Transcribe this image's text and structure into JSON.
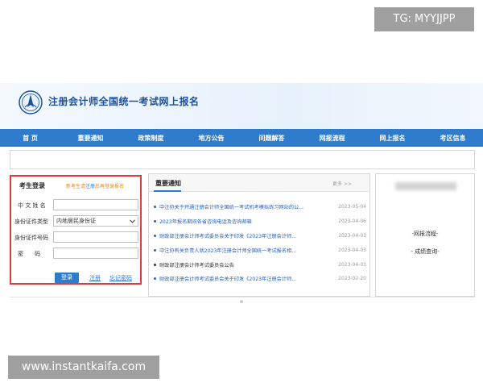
{
  "watermarks": {
    "top": "TG: MYYJJPP",
    "bottom": "www.instantkaifa.com"
  },
  "header": {
    "title": "注册会计师全国统一考试网上报名",
    "logo_icon": "cicpa-logo-icon"
  },
  "nav": {
    "items": [
      {
        "label": "首 页"
      },
      {
        "label": "重要通知"
      },
      {
        "label": "政策制度"
      },
      {
        "label": "地方公告"
      },
      {
        "label": "问题解答"
      },
      {
        "label": "网报流程"
      },
      {
        "label": "网上报名"
      },
      {
        "label": "考区信息"
      }
    ]
  },
  "login": {
    "title": "考生登录",
    "hint_prefix": "新考生请",
    "hint_link": "注册",
    "hint_suffix": "后再登录报名",
    "name_label": "中 文 姓 名",
    "name_value": "",
    "id_type_label": "身份证件类型",
    "id_type_value": "内地居民身份证",
    "id_number_label": "身份证件号码",
    "id_number_value": "",
    "password_label": "密　　码",
    "password_value": "",
    "login_button": "登录",
    "register_link": "注册",
    "forgot_link": "忘记密码"
  },
  "notices": {
    "title": "重要通知",
    "more": "更多 >>",
    "items": [
      {
        "title": "中注协关于开通注册会计师全国统一考试机考模拟练习网站的公...",
        "date": "2023-05-04",
        "color": "#2a62b6"
      },
      {
        "title": "2023年报名期间各省咨询电话及咨询邮箱",
        "date": "2023-04-06",
        "color": "#2a62b6"
      },
      {
        "title": "财政部注册会计师考试委员会关于印发《2023年注册会计师...",
        "date": "2023-04-03",
        "color": "#2a62b6"
      },
      {
        "title": "中注协有关负责人就2023年注册会计师全国统一考试报名相...",
        "date": "2023-04-03",
        "color": "#2a62b6"
      },
      {
        "title": "财政部注册会计师考试委员会公告",
        "date": "2023-04-03",
        "color": "#333333"
      },
      {
        "title": "财政部注册会计师考试委员会关于印发《2023年注册会计师...",
        "date": "2023-02-20",
        "color": "#2a62b6"
      }
    ]
  },
  "right_panel": {
    "link1": "-网报流程-",
    "link2": "- 成绩查询-"
  },
  "colors": {
    "nav": "#2f7bcc",
    "login_border": "#e23b3b",
    "brand": "#1c4f9c"
  }
}
